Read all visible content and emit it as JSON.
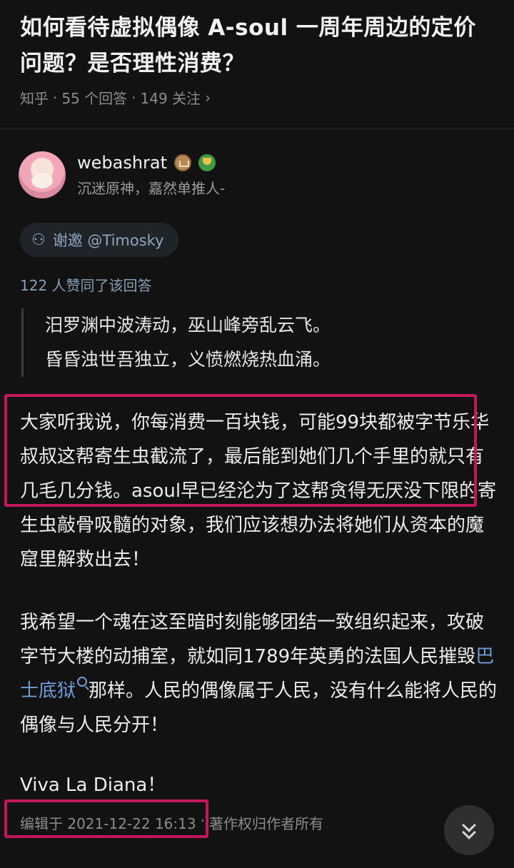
{
  "question": {
    "title_line1": "如何看待虚拟偶像 A-soul 一周年周边的定价",
    "title_line2": "问题？是否理性消费？",
    "source": "知乎",
    "sep": "·",
    "answers": "55 个回答",
    "followers": "149 关注",
    "chevron": "›"
  },
  "author": {
    "name": "webashrat",
    "bio": "沉迷原神，嘉然单推人-"
  },
  "invite": {
    "label": "谢邀 @Timosky"
  },
  "likes_line": "122 人赞同了该回答",
  "quote": {
    "line1": "汨罗渊中波涛动，巫山峰旁乱云飞。",
    "line2": "昏昏浊世吾独立，义愤燃烧热血涌。"
  },
  "body": {
    "para1": "大家听我说，你每消费一百块钱，可能99块都被字节乐华叔叔这帮寄生虫截流了，最后能到她们几个手里的就只有几毛几分钱。asoul早已经沦为了这帮贪得无厌没下限的寄生虫敲骨吸髓的对象，我们应该想办法将她们从资本的魔窟里解救出去！",
    "para2_part1": "我希望一个魂在这至暗时刻能够团结一致组织起来，攻破字节大楼的动捕室，就如同1789年英勇的法国人民摧毁",
    "para2_link": "巴士底狱",
    "para2_part2": "那样。人民的偶像属于人民，没有什么能将人民的偶像与人民分开！",
    "para3": "Viva La Diana！"
  },
  "footer": {
    "edited": "编辑于 2021-12-22 16:13",
    "sep": "·",
    "copyright": "著作权归作者所有"
  },
  "colors": {
    "background": "#121212",
    "highlight": "#c2185b",
    "link": "#6f9dd8"
  },
  "icons": [
    "chevron-right-icon",
    "crown-badge-icon",
    "trophy-badge-icon",
    "invite-icon",
    "search-icon",
    "double-chevron-down-icon"
  ]
}
